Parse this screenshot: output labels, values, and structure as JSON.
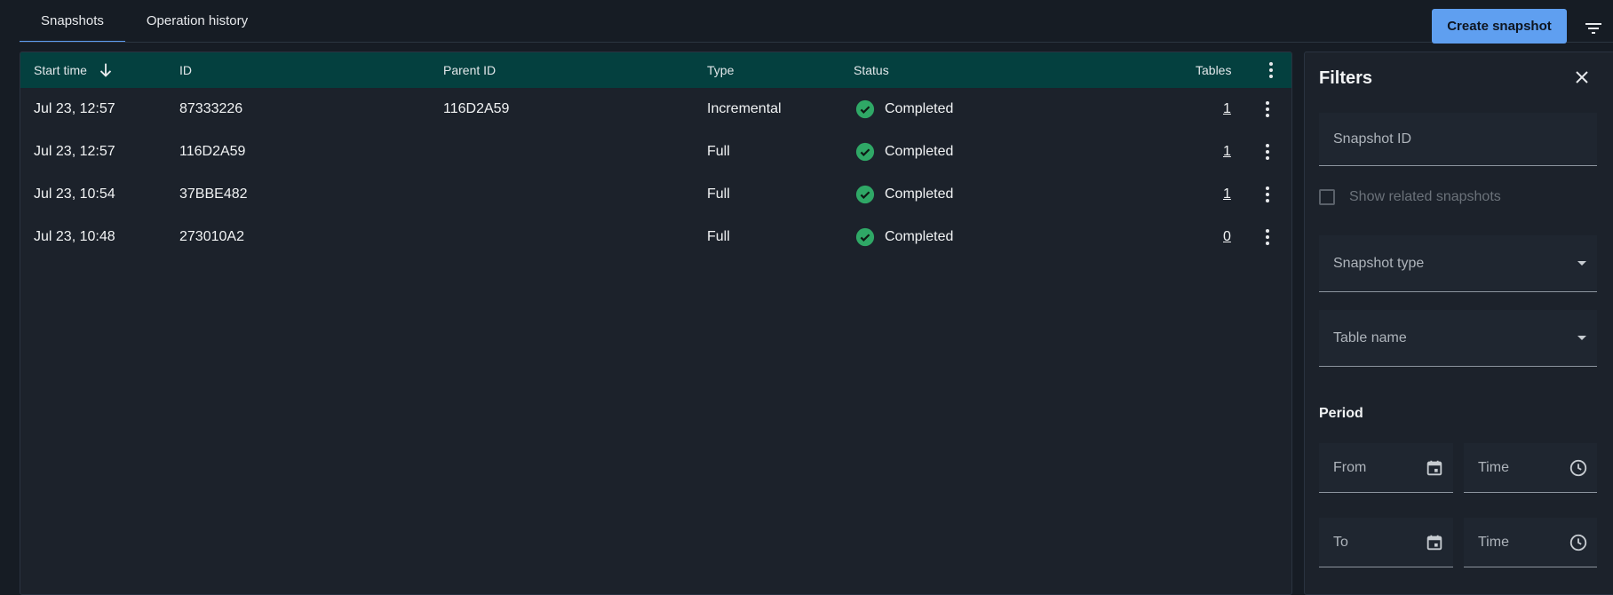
{
  "tabs": [
    {
      "label": "Snapshots",
      "active": true
    },
    {
      "label": "Operation history",
      "active": false
    }
  ],
  "toolbar": {
    "create_label": "Create snapshot",
    "filter_icon": "filter-list-icon"
  },
  "colors": {
    "background": "#161c24",
    "header": "#04403f",
    "accent": "#5f9ff0",
    "success": "#2fa866"
  },
  "table": {
    "columns": {
      "start_time": "Start time",
      "id": "ID",
      "parent_id": "Parent ID",
      "type": "Type",
      "status": "Status",
      "tables": "Tables"
    },
    "sort": {
      "column": "start_time",
      "direction": "desc",
      "icon": "arrow-down-icon"
    },
    "rows": [
      {
        "start_time": "Jul 23, 12:57",
        "id": "87333226",
        "parent_id": "116D2A59",
        "type": "Incremental",
        "status": "Completed",
        "tables": "1"
      },
      {
        "start_time": "Jul 23, 12:57",
        "id": "116D2A59",
        "parent_id": "",
        "type": "Full",
        "status": "Completed",
        "tables": "1"
      },
      {
        "start_time": "Jul 23, 10:54",
        "id": "37BBE482",
        "parent_id": "",
        "type": "Full",
        "status": "Completed",
        "tables": "1"
      },
      {
        "start_time": "Jul 23, 10:48",
        "id": "273010A2",
        "parent_id": "",
        "type": "Full",
        "status": "Completed",
        "tables": "0"
      }
    ]
  },
  "filters": {
    "title": "Filters",
    "snapshot_id_placeholder": "Snapshot ID",
    "show_related_label": "Show related snapshots",
    "show_related_checked": false,
    "snapshot_type_placeholder": "Snapshot type",
    "table_name_placeholder": "Table name",
    "period_label": "Period",
    "from_label": "From",
    "to_label": "To",
    "time_label": "Time"
  }
}
